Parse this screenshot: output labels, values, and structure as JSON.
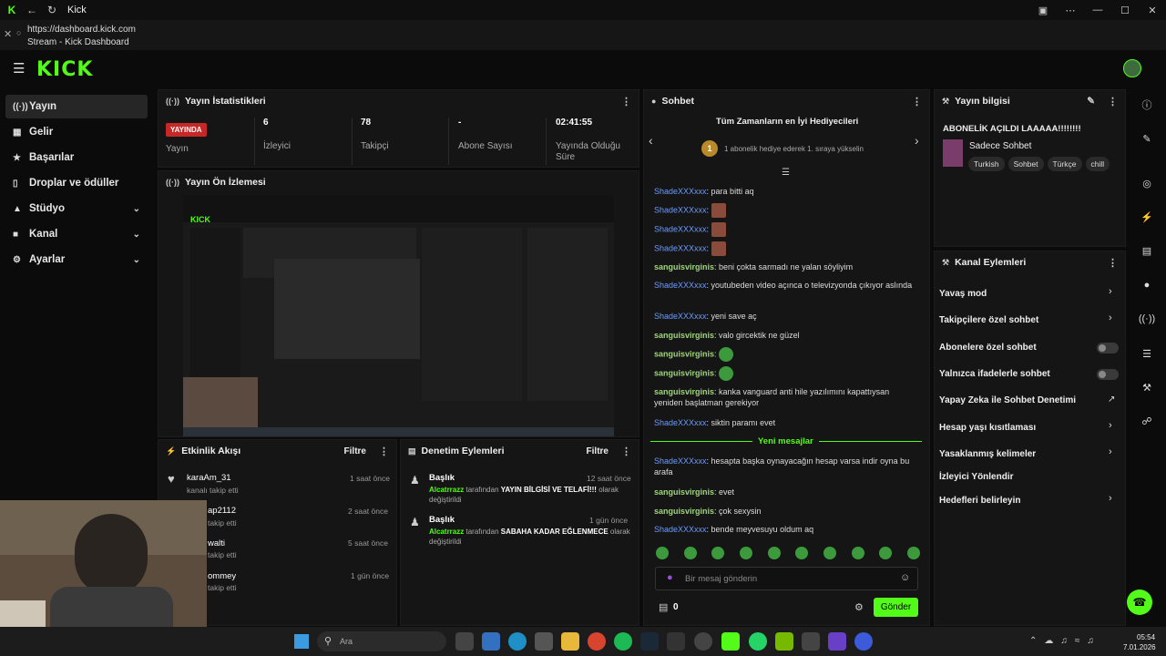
{
  "browser": {
    "tab_title": "Kick",
    "url": "https://dashboard.kick.com",
    "page_title": "Stream - Kick Dashboard"
  },
  "brand": {
    "logo_text": "KICK",
    "accent": "#53fc18"
  },
  "sidebar": {
    "items": [
      {
        "label": "Yayın",
        "icon": "stream-icon",
        "active": true
      },
      {
        "label": "Gelir",
        "icon": "revenue-icon"
      },
      {
        "label": "Başarılar",
        "icon": "trophy-icon"
      },
      {
        "label": "Droplar ve ödüller",
        "icon": "gift-icon"
      },
      {
        "label": "Stüdyo",
        "icon": "studio-icon",
        "expandable": true
      },
      {
        "label": "Kanal",
        "icon": "channel-icon",
        "expandable": true
      },
      {
        "label": "Ayarlar",
        "icon": "gear-icon",
        "expandable": true
      }
    ]
  },
  "stats": {
    "title": "Yayın İstatistikleri",
    "live_badge": "YAYINDA",
    "live_label": "Yayın",
    "viewers_value": "6",
    "viewers_label": "İzleyici",
    "followers_value": "78",
    "followers_label": "Takipçi",
    "subs_value": "-",
    "subs_label": "Abone Sayısı",
    "uptime_value": "02:41:55",
    "uptime_label": "Yayında Olduğu Süre"
  },
  "preview": {
    "title": "Yayın Ön İzlemesi"
  },
  "activity": {
    "title": "Etkinlik Akışı",
    "filter": "Filtre",
    "items": [
      {
        "name": "karaAm_31",
        "action": "kanalı takip etti",
        "time": "1 saat önce"
      },
      {
        "name": "ap2112",
        "action": "takip etti",
        "time": "2 saat önce"
      },
      {
        "name": "walti",
        "action": "takip etti",
        "time": "5 saat önce"
      },
      {
        "name": "ommey",
        "action": "takip etti",
        "time": "1 gün önce"
      }
    ]
  },
  "moderation": {
    "title": "Denetim Eylemleri",
    "filter": "Filtre",
    "items": [
      {
        "heading": "Başlık",
        "user": "Alcatrrazz",
        "text_a": "tarafından",
        "value": "YAYIN BİLGİSİ VE TELAFİ!!!",
        "text_b": "olarak değiştirildi",
        "time": "12 saat önce"
      },
      {
        "heading": "Başlık",
        "user": "Alcatrrazz",
        "text_a": "tarafından",
        "value": "SABAHA KADAR EĞLENMECE",
        "text_b": "olarak değiştirildi",
        "time": "1 gün önce"
      }
    ]
  },
  "chat": {
    "title": "Sohbet",
    "gifters_title": "Tüm Zamanların en İyi Hediyecileri",
    "gifters_rank": "1",
    "gifters_text": "1 abonelik hediye ederek 1. sıraya yükselin",
    "messages": [
      {
        "user": "ShadeXXXxxx",
        "text": ": para bitti aq",
        "color": "blue"
      },
      {
        "user": "ShadeXXXxxx",
        "text": ":",
        "emote": "face",
        "color": "blue"
      },
      {
        "user": "ShadeXXXxxx",
        "text": ":",
        "emote": "face",
        "color": "blue"
      },
      {
        "user": "ShadeXXXxxx",
        "text": ":",
        "emote": "face",
        "color": "blue"
      },
      {
        "user": "sanguisvirginis",
        "text": ": beni çokta sarmadı ne yalan söyliyim",
        "color": "green"
      },
      {
        "user": "ShadeXXXxxx",
        "text": ": youtubeden video açınca o televizyonda çıkıyor aslında",
        "color": "blue"
      },
      {
        "user": "ShadeXXXxxx",
        "text": ": yeni save aç",
        "color": "blue"
      },
      {
        "user": "sanguisvirginis",
        "text": ": valo gircektik ne güzel",
        "color": "green"
      },
      {
        "user": "sanguisvirginis",
        "text": ":",
        "emote": "green",
        "color": "green"
      },
      {
        "user": "sanguisvirginis",
        "text": ":",
        "emote": "green",
        "color": "green"
      },
      {
        "user": "sanguisvirginis",
        "text": ": kanka vanguard anti hile yazılımını kapattıysan yeniden başlatman gerekiyor",
        "color": "green"
      },
      {
        "user": "ShadeXXXxxx",
        "text": ": siktin paramı evet",
        "color": "blue"
      },
      {
        "user": "ShadeXXXxxx",
        "text": ": hesapta başka oynayacağın hesap varsa indir oyna bu arafa",
        "color": "blue"
      },
      {
        "user": "sanguisvirginis",
        "text": ": evet",
        "color": "green"
      },
      {
        "user": "sanguisvirginis",
        "text": ": çok sexysin",
        "color": "green"
      },
      {
        "user": "ShadeXXXxxx",
        "text": ": bende meyvesuyu oldum aq",
        "color": "blue"
      }
    ],
    "new_messages": "Yeni mesajlar",
    "input_placeholder": "Bir mesaj gönderin",
    "count": "0",
    "send": "Gönder"
  },
  "stream_info": {
    "title": "Yayın bilgisi",
    "stream_title": "ABONELİK AÇILDI LAAAAA!!!!!!!!",
    "category": "Sadece Sohbet",
    "tags": [
      "Turkish",
      "Sohbet",
      "Türkçe",
      "chill"
    ]
  },
  "channel_actions": {
    "title": "Kanal Eylemleri",
    "items": [
      {
        "label": "Yavaş mod",
        "ctl": "chevron"
      },
      {
        "label": "Takipçilere özel sohbet",
        "ctl": "chevron"
      },
      {
        "label": "Abonelere özel sohbet",
        "ctl": "toggle"
      },
      {
        "label": "Yalnızca ifadelerle sohbet",
        "ctl": "toggle"
      },
      {
        "label": "Yapay Zeka ile Sohbet Denetimi",
        "ctl": "external"
      },
      {
        "label": "Hesap yaşı kısıtlaması",
        "ctl": "chevron"
      },
      {
        "label": "Yasaklanmış kelimeler",
        "ctl": "chevron"
      },
      {
        "label": "İzleyici Yönlendir",
        "ctl": "none"
      },
      {
        "label": "Hedefleri belirleyin",
        "ctl": "chevron"
      }
    ]
  },
  "taskbar": {
    "search_placeholder": "Ara",
    "time": "05:54",
    "date": "7.01.2026"
  }
}
